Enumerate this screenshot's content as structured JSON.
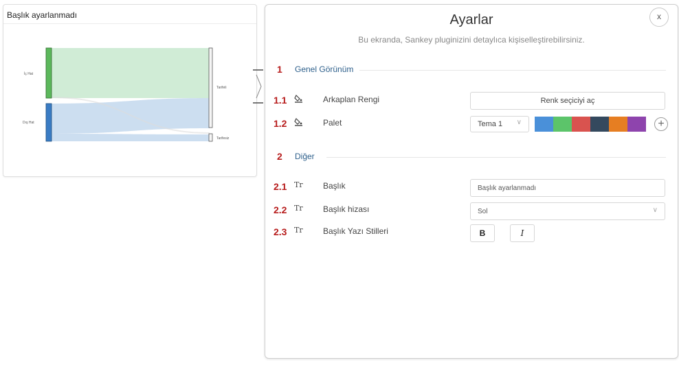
{
  "chart_card": {
    "title": "Başlık ayarlanmadı",
    "nodes": {
      "source_1": "İç Hat",
      "source_2": "Dış Hat",
      "target_1": "Tarifeli",
      "target_2": "Tarifesiz"
    },
    "colors": {
      "node_1": "#5cb85c",
      "node_2": "#3a7cc4",
      "link_1": "#cdebd4",
      "link_2": "#c9dcef"
    }
  },
  "panel": {
    "title": "Ayarlar",
    "subtitle": "Bu ekranda, Sankey pluginizini detaylıca kişiselleştirebilirsiniz.",
    "close_label": "x",
    "section1": {
      "num": "1",
      "name": "Genel Görünüm"
    },
    "row_1_1": {
      "num": "1.1",
      "icon": "paint-bucket-icon",
      "label": "Arkaplan Rengi",
      "button_label": "Renk seçiciyi aç"
    },
    "row_1_2": {
      "num": "1.2",
      "icon": "paint-bucket-icon",
      "label": "Palet",
      "select_value": "Tema 1",
      "palette": [
        "#4a90d9",
        "#5cc46a",
        "#d9534f",
        "#34495e",
        "#e67e22",
        "#8e44ad"
      ]
    },
    "section2": {
      "num": "2",
      "name": "Diğer"
    },
    "row_2_1": {
      "num": "2.1",
      "icon_text": "Tr",
      "label": "Başlık",
      "input_value": "Başlık ayarlanmadı"
    },
    "row_2_2": {
      "num": "2.2",
      "icon_text": "Tr",
      "label": "Başlık hizası",
      "select_value": "Sol"
    },
    "row_2_3": {
      "num": "2.3",
      "icon_text": "Tr",
      "label": "Başlık Yazı Stilleri",
      "bold_label": "B",
      "italic_label": "I"
    }
  }
}
